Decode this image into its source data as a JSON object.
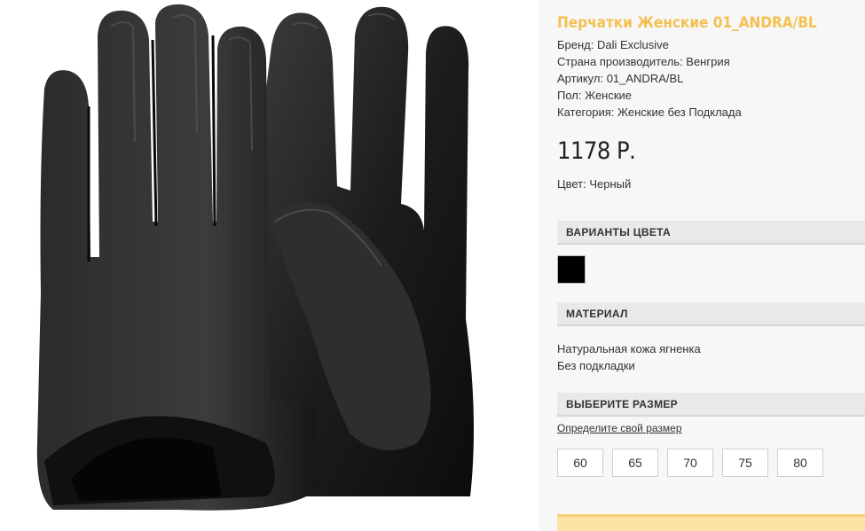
{
  "product": {
    "title": "Перчатки Женские 01_ANDRA/BL",
    "properties": [
      {
        "label": "Бренд: Dali Exclusive"
      },
      {
        "label": "Страна производитель: Венгрия"
      },
      {
        "label": "Артикул: 01_ANDRA/BL"
      },
      {
        "label": "Пол: Женские"
      },
      {
        "label": "Категория: Женские без Подклада"
      }
    ],
    "price": "1178 Р.",
    "color": "Цвет: Черный"
  },
  "color_variants": {
    "header": "ВАРИАНТЫ ЦВЕТА",
    "swatches": [
      {
        "color": "#000000"
      }
    ]
  },
  "material": {
    "header": "МАТЕРИАЛ",
    "lines": [
      "Натуральная кожа ягненка",
      "Без подкладки"
    ]
  },
  "size": {
    "header": "ВЫБЕРИТЕ РАЗМЕР",
    "link": "Определите свой размер",
    "options": [
      "60",
      "65",
      "70",
      "75",
      "80"
    ]
  },
  "colors": {
    "title_accent": "#f4c150",
    "panel_bg": "#f7f7f7",
    "header_bg": "#e9e9e9",
    "bottom_bar": "#fbe3a6"
  }
}
